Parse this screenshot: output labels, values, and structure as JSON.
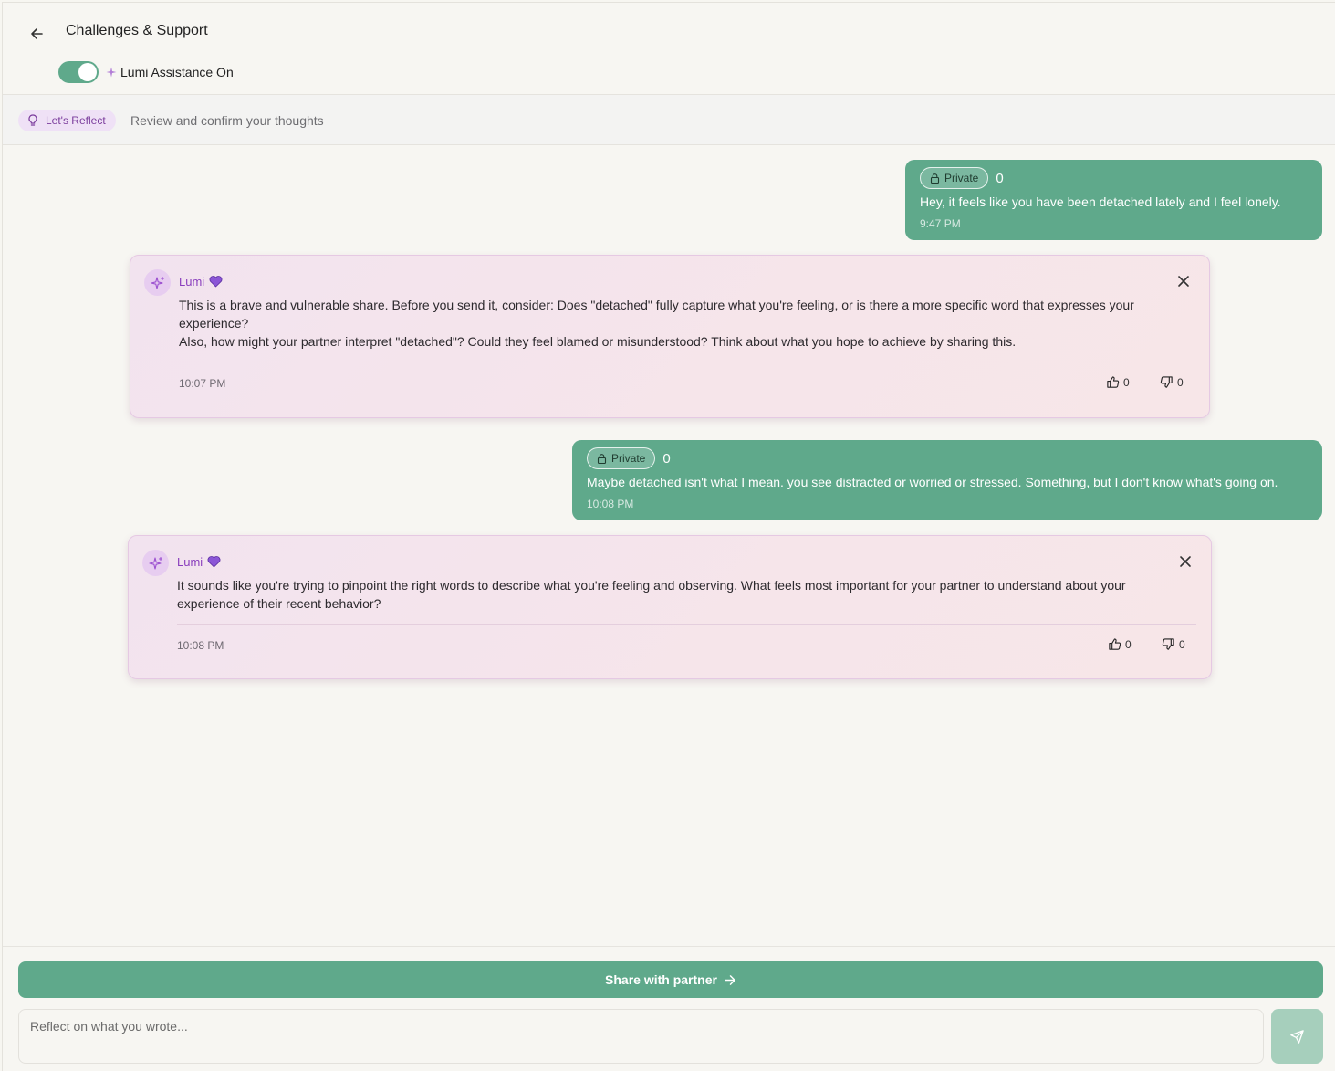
{
  "header": {
    "title": "Challenges & Support",
    "assistant_toggle": {
      "label": "Lumi Assistance On",
      "on": true
    }
  },
  "reflect": {
    "pill_label": "Let's Reflect",
    "hint": "Review and confirm your thoughts"
  },
  "messages": [
    {
      "badge": "Private",
      "count": "0",
      "text": "Hey, it feels like you have been detached lately and I feel lonely.",
      "time": "9:47 PM"
    },
    {
      "badge": "Private",
      "count": "0",
      "text": "Maybe detached isn't what I mean. you see distracted or worried or stressed. Something, but I don't know what's going on.",
      "time": "10:08 PM"
    }
  ],
  "lumi": [
    {
      "name": "Lumi",
      "paragraph1": "This is a brave and vulnerable share. Before you send it, consider: Does \"detached\" fully capture what you're feeling, or is there a more specific word that expresses your experience?",
      "paragraph2": "Also, how might your partner interpret \"detached\"? Could they feel blamed or misunderstood? Think about what you hope to achieve by sharing this.",
      "time": "10:07 PM",
      "likes": "0",
      "dislikes": "0"
    },
    {
      "name": "Lumi",
      "paragraph1": "It sounds like you're trying to pinpoint the right words to describe what you're feeling and observing. What feels most important for your partner to understand about your experience of their recent behavior?",
      "time": "10:08 PM",
      "likes": "0",
      "dislikes": "0"
    }
  ],
  "footer": {
    "share_label": "Share with partner",
    "input_placeholder": "Reflect on what you wrote..."
  },
  "colors": {
    "accent_green": "#5fa98b",
    "lumi_purple": "#8a3fbd",
    "send_disabled": "#a6cfbc"
  }
}
